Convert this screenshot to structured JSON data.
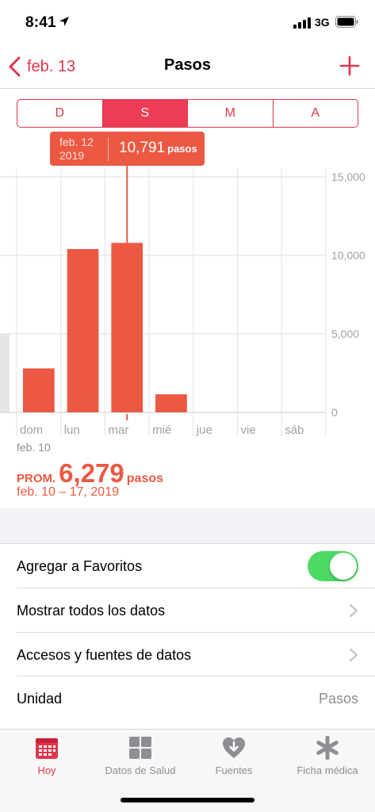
{
  "status_bar": {
    "time": "8:41",
    "network": "3G"
  },
  "nav": {
    "back_label": "feb. 13",
    "title": "Pasos"
  },
  "segments": [
    {
      "label": "D",
      "active": false
    },
    {
      "label": "S",
      "active": true
    },
    {
      "label": "M",
      "active": false
    },
    {
      "label": "A",
      "active": false
    }
  ],
  "tooltip": {
    "date": "feb. 12",
    "year": "2019",
    "value": "10,791",
    "unit": "pasos"
  },
  "chart_data": {
    "type": "bar",
    "categories": [
      "dom",
      "lun",
      "mar",
      "mié",
      "jue",
      "vie",
      "sáb"
    ],
    "values": [
      2800,
      10400,
      10791,
      1150,
      0,
      0,
      0
    ],
    "ylim": [
      0,
      15000
    ],
    "y_ticks": [
      "15,000",
      "10,000",
      "5,000",
      "0"
    ],
    "y_tick_values": [
      15000,
      10000,
      5000,
      0
    ],
    "previous_week_value": 5000,
    "selected_index": 2,
    "grid": true,
    "bar_color": "#ec5842"
  },
  "week_start": "feb. 10",
  "average": {
    "label": "PROM.",
    "value": "6,279",
    "unit": "pasos",
    "range": "feb. 10 – 17, 2019"
  },
  "settings": {
    "favorites": {
      "label": "Agregar a Favoritos",
      "on": true
    },
    "show_all": {
      "label": "Mostrar todos los datos"
    },
    "sources": {
      "label": "Accesos y fuentes de datos"
    },
    "unit": {
      "label": "Unidad",
      "value": "Pasos"
    }
  },
  "tabs": [
    {
      "label": "Hoy",
      "icon": "calendar-icon",
      "active": true
    },
    {
      "label": "Datos de Salud",
      "icon": "grid-icon",
      "active": false
    },
    {
      "label": "Fuentes",
      "icon": "heart-download-icon",
      "active": false
    },
    {
      "label": "Ficha médica",
      "icon": "asterisk-icon",
      "active": false
    }
  ],
  "colors": {
    "accent": "#e2354b",
    "bar": "#ec5842",
    "toggle": "#4cd964"
  }
}
